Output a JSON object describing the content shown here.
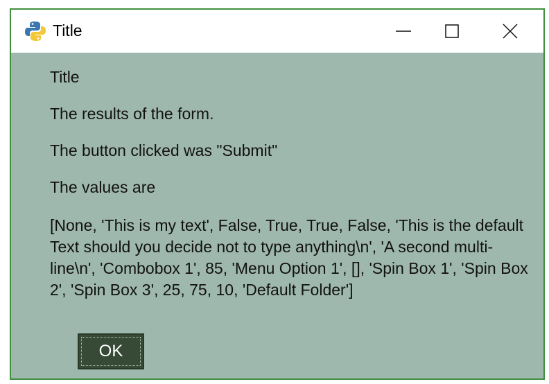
{
  "window": {
    "title": "Title",
    "icon": "python-icon",
    "controls": [
      "minimize-icon",
      "maximize-icon",
      "close-icon"
    ]
  },
  "content": {
    "heading": "Title",
    "results_text": "The results of the form.",
    "button_clicked": "The button clicked was \"Submit\"",
    "values_label": "The values are",
    "values": "[None, 'This is my text', False, True, True, False, 'This is the default Text should you decide not to type anything\\n', 'A second multi-line\\n', 'Combobox 1', 85, 'Menu Option 1', [], 'Spin Box 1', 'Spin Box 2', 'Spin Box 3', 25, 75, 10, 'Default Folder']"
  },
  "ok_button": {
    "label": "OK"
  },
  "colors": {
    "window_bg": "#9fb8ad",
    "border": "#3f8f3f",
    "button_bg": "#364a36",
    "button_text": "#ffffff"
  }
}
